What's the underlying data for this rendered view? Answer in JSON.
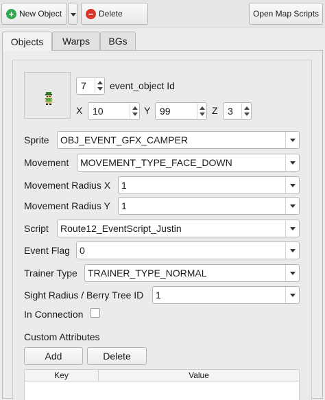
{
  "toolbar": {
    "new_object_label": "New Object",
    "delete_label": "Delete",
    "open_scripts_label": "Open Map Scripts"
  },
  "tabs": [
    {
      "label": "Objects",
      "active": true
    },
    {
      "label": "Warps",
      "active": false
    },
    {
      "label": "BGs",
      "active": false
    }
  ],
  "object": {
    "id_value": "7",
    "id_label": "event_object Id",
    "x_label": "X",
    "x_value": "10",
    "y_label": "Y",
    "y_value": "99",
    "z_label": "Z",
    "z_value": "3"
  },
  "fields": {
    "sprite_label": "Sprite",
    "sprite_value": "OBJ_EVENT_GFX_CAMPER",
    "movement_label": "Movement",
    "movement_value": "MOVEMENT_TYPE_FACE_DOWN",
    "radius_x_label": "Movement Radius X",
    "radius_x_value": "1",
    "radius_y_label": "Movement Radius Y",
    "radius_y_value": "1",
    "script_label": "Script",
    "script_value": "Route12_EventScript_Justin",
    "event_flag_label": "Event Flag",
    "event_flag_value": "0",
    "trainer_type_label": "Trainer Type",
    "trainer_type_value": "TRAINER_TYPE_NORMAL",
    "sight_label": "Sight Radius / Berry Tree ID",
    "sight_value": "1",
    "in_connection_label": "In Connection",
    "in_connection_checked": false
  },
  "custom_attributes": {
    "title": "Custom Attributes",
    "add_label": "Add",
    "delete_label": "Delete",
    "columns": [
      "Key",
      "Value"
    ],
    "rows": []
  },
  "icons": {
    "add": "plus-circle-icon",
    "delete": "minus-circle-icon",
    "sprite": "camper-sprite-icon"
  }
}
